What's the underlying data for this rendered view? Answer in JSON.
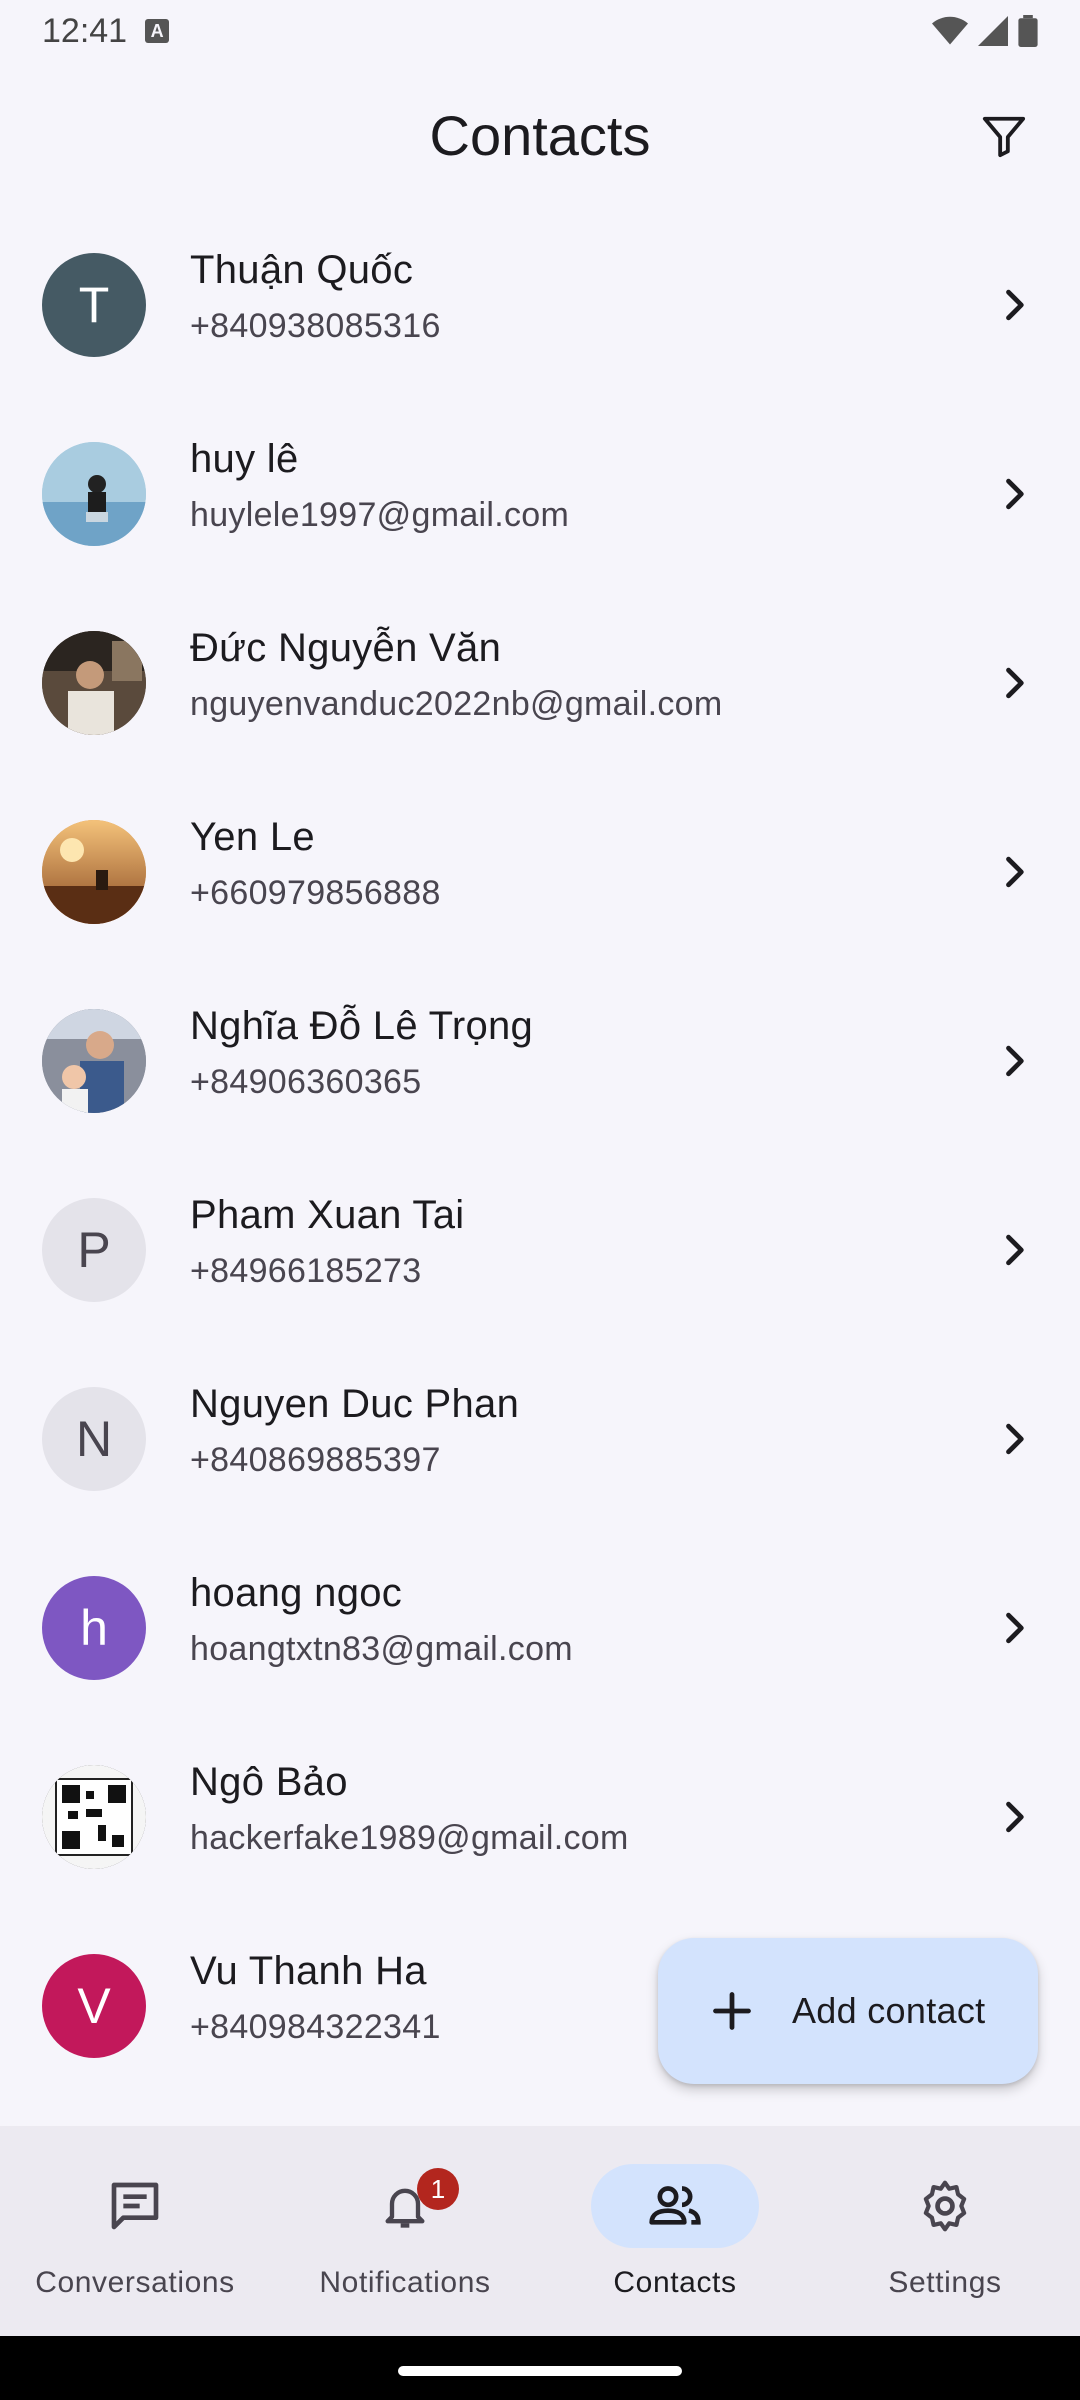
{
  "status_bar": {
    "time": "12:41",
    "notification_icon": "A"
  },
  "header": {
    "title": "Contacts",
    "filter_icon": "filter-icon"
  },
  "contacts": [
    {
      "name": "Thuận Quốc",
      "detail": "+840938085316",
      "initial": "T",
      "avatar_color": "#455a64",
      "initial_color": "#ffffff",
      "photo": false
    },
    {
      "name": "huy lê",
      "detail": "huylele1997@gmail.com",
      "initial": "",
      "avatar_color": "#a9cce0",
      "initial_color": "#ffffff",
      "photo": true
    },
    {
      "name": "Đức Nguyễn Văn",
      "detail": "nguyenvanduc2022nb@gmail.com",
      "initial": "",
      "avatar_color": "#5a4a3c",
      "initial_color": "#ffffff",
      "photo": true
    },
    {
      "name": "Yen Le",
      "detail": "+660979856888",
      "initial": "",
      "avatar_color": "#d9924a",
      "initial_color": "#ffffff",
      "photo": true
    },
    {
      "name": "Nghĩa Đỗ Lê Trọng",
      "detail": "+84906360365",
      "initial": "",
      "avatar_color": "#8a8f9c",
      "initial_color": "#ffffff",
      "photo": true
    },
    {
      "name": "Pham Xuan Tai",
      "detail": "+84966185273",
      "initial": "P",
      "avatar_color": "#e4e3ea",
      "initial_color": "#49454f",
      "photo": false
    },
    {
      "name": "Nguyen Duc Phan",
      "detail": "+840869885397",
      "initial": "N",
      "avatar_color": "#e4e3ea",
      "initial_color": "#49454f",
      "photo": false
    },
    {
      "name": "hoang ngoc",
      "detail": "hoangtxtn83@gmail.com",
      "initial": "h",
      "avatar_color": "#7e57c2",
      "initial_color": "#ffffff",
      "photo": false
    },
    {
      "name": "Ngô Bảo",
      "detail": "hackerfake1989@gmail.com",
      "initial": "",
      "avatar_color": "#3a3a3a",
      "initial_color": "#ffffff",
      "photo": true
    },
    {
      "name": "Vu Thanh Ha",
      "detail": "+840984322341",
      "initial": "V",
      "avatar_color": "#c2185b",
      "initial_color": "#ffffff",
      "photo": false
    }
  ],
  "fab": {
    "label": "Add contact",
    "icon": "plus-icon"
  },
  "nav": [
    {
      "label": "Conversations",
      "icon": "chat-icon",
      "active": false,
      "badge": ""
    },
    {
      "label": "Notifications",
      "icon": "bell-icon",
      "active": false,
      "badge": "1"
    },
    {
      "label": "Contacts",
      "icon": "people-icon",
      "active": true,
      "badge": ""
    },
    {
      "label": "Settings",
      "icon": "gear-icon",
      "active": false,
      "badge": ""
    }
  ],
  "colors": {
    "background": "#f6f5fb",
    "accent": "#d3e3fd",
    "nav_background": "#eceaf1",
    "badge": "#b3261e"
  }
}
